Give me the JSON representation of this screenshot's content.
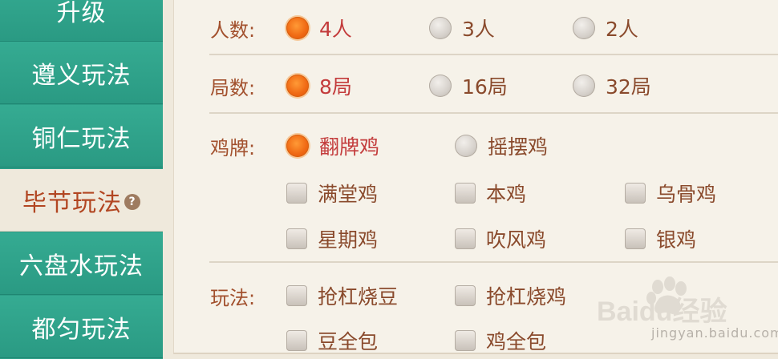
{
  "sidebar": {
    "items": [
      {
        "label": "升级"
      },
      {
        "label": "遵义玩法"
      },
      {
        "label": "铜仁玩法"
      },
      {
        "label": "毕节玩法",
        "help": "?"
      },
      {
        "label": "六盘水玩法"
      },
      {
        "label": "都匀玩法"
      }
    ]
  },
  "settings": {
    "players": {
      "label": "人数:",
      "options": [
        "4人",
        "3人",
        "2人"
      ],
      "selected": "4人"
    },
    "rounds": {
      "label": "局数:",
      "options": [
        "8局",
        "16局",
        "32局"
      ],
      "selected": "8局"
    },
    "chicken": {
      "label": "鸡牌:",
      "radio_options": [
        "翻牌鸡",
        "摇摆鸡"
      ],
      "selected": "翻牌鸡",
      "checkboxes": [
        "满堂鸡",
        "本鸡",
        "乌骨鸡",
        "星期鸡",
        "吹风鸡",
        "银鸡"
      ]
    },
    "rules": {
      "label": "玩法:",
      "checkboxes": [
        "抢杠烧豆",
        "抢杠烧鸡",
        "豆全包",
        "鸡全包"
      ]
    }
  },
  "watermark": {
    "logo": "Baidu经验",
    "url": "jingyan.baidu.com"
  },
  "colors": {
    "sidebar": "#2c9d86",
    "accent": "#f06a14",
    "label": "#a2502d",
    "selected_text": "#c33b3b"
  }
}
